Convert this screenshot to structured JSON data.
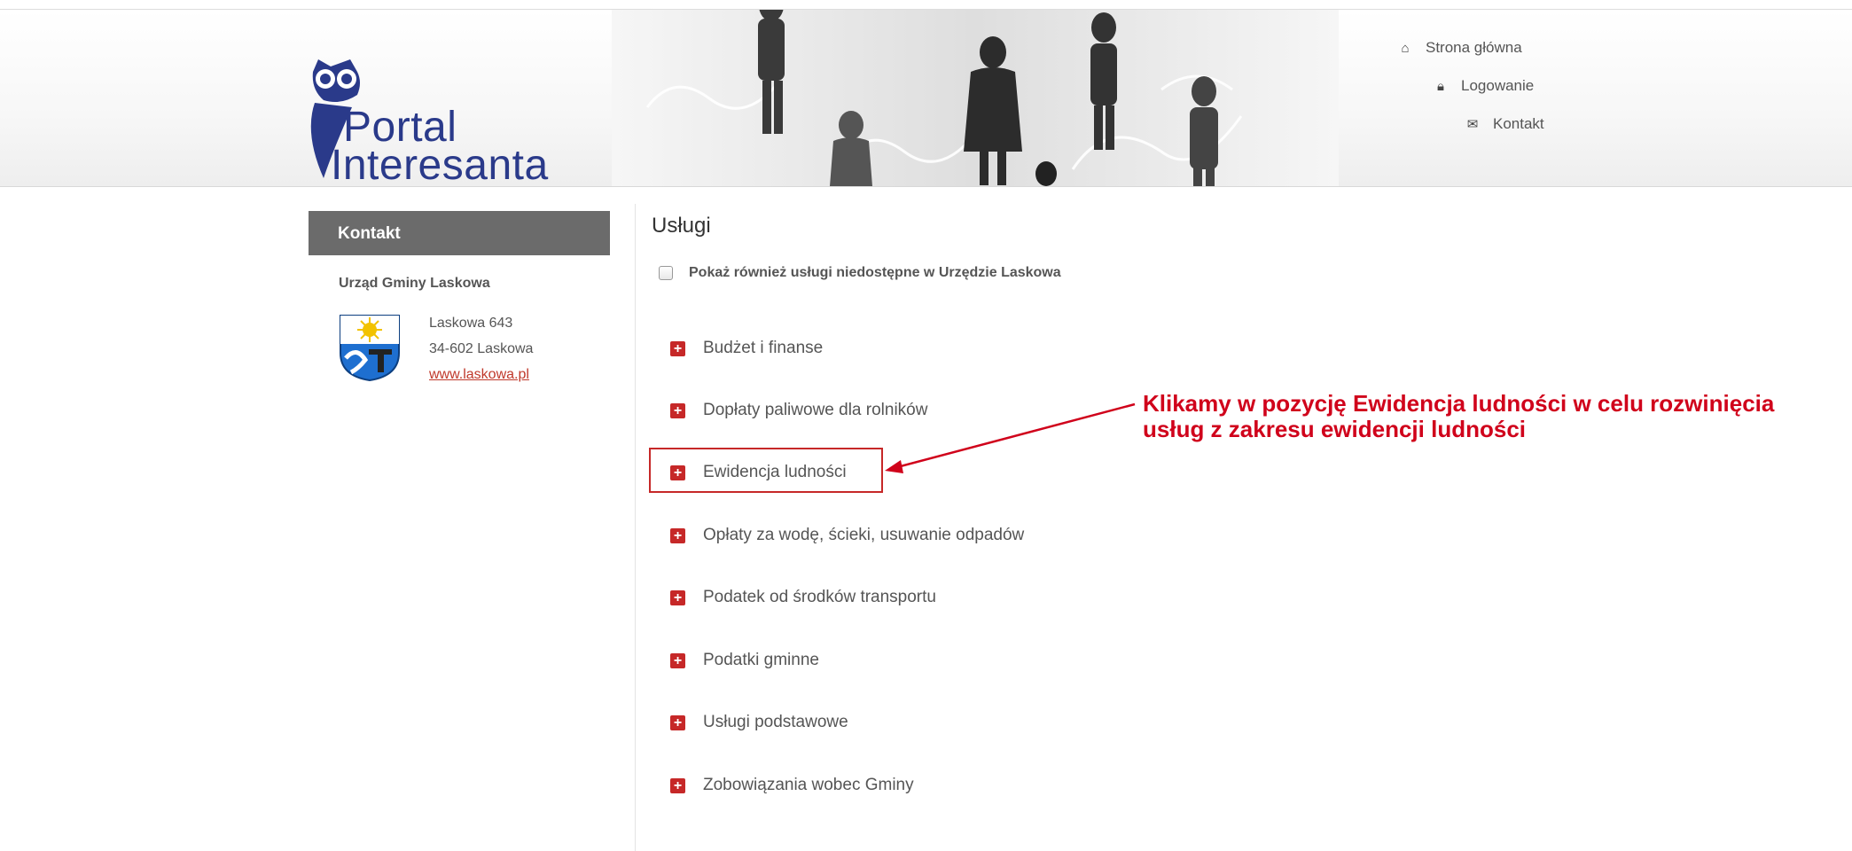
{
  "header": {
    "logo": {
      "line1": "Portal",
      "line2": "Interesanta"
    },
    "nav": [
      {
        "icon": "home-icon",
        "label": "Strona główna"
      },
      {
        "icon": "lock-icon",
        "label": "Logowanie"
      },
      {
        "icon": "envelope-icon",
        "label": "Kontakt"
      }
    ]
  },
  "sidebar": {
    "heading": "Kontakt",
    "office": "Urząd Gminy Laskowa",
    "address_line1": "Laskowa 643",
    "address_line2": "34-602 Laskowa",
    "website": "www.laskowa.pl"
  },
  "main": {
    "title": "Usługi",
    "show_unavailable_label": "Pokaż również usługi niedostępne w Urzędzie Laskowa",
    "show_unavailable_checked": false,
    "services": [
      "Budżet i finanse",
      "Dopłaty paliwowe dla rolników",
      "Ewidencja ludności",
      "Opłaty za wodę, ścieki, usuwanie odpadów",
      "Podatek od środków transportu",
      "Podatki gminne",
      "Usługi podstawowe",
      "Zobowiązania wobec Gminy"
    ]
  },
  "annotation": {
    "line1": "Klikamy w pozycję Ewidencja ludności w celu rozwinięcia",
    "line2": "usług z zakresu ewidencji ludności",
    "color": "#d0021b"
  },
  "colors": {
    "accent_red": "#c62828",
    "sidebar_header_bg": "#6b6b6b",
    "logo_blue": "#2a3a8a"
  }
}
